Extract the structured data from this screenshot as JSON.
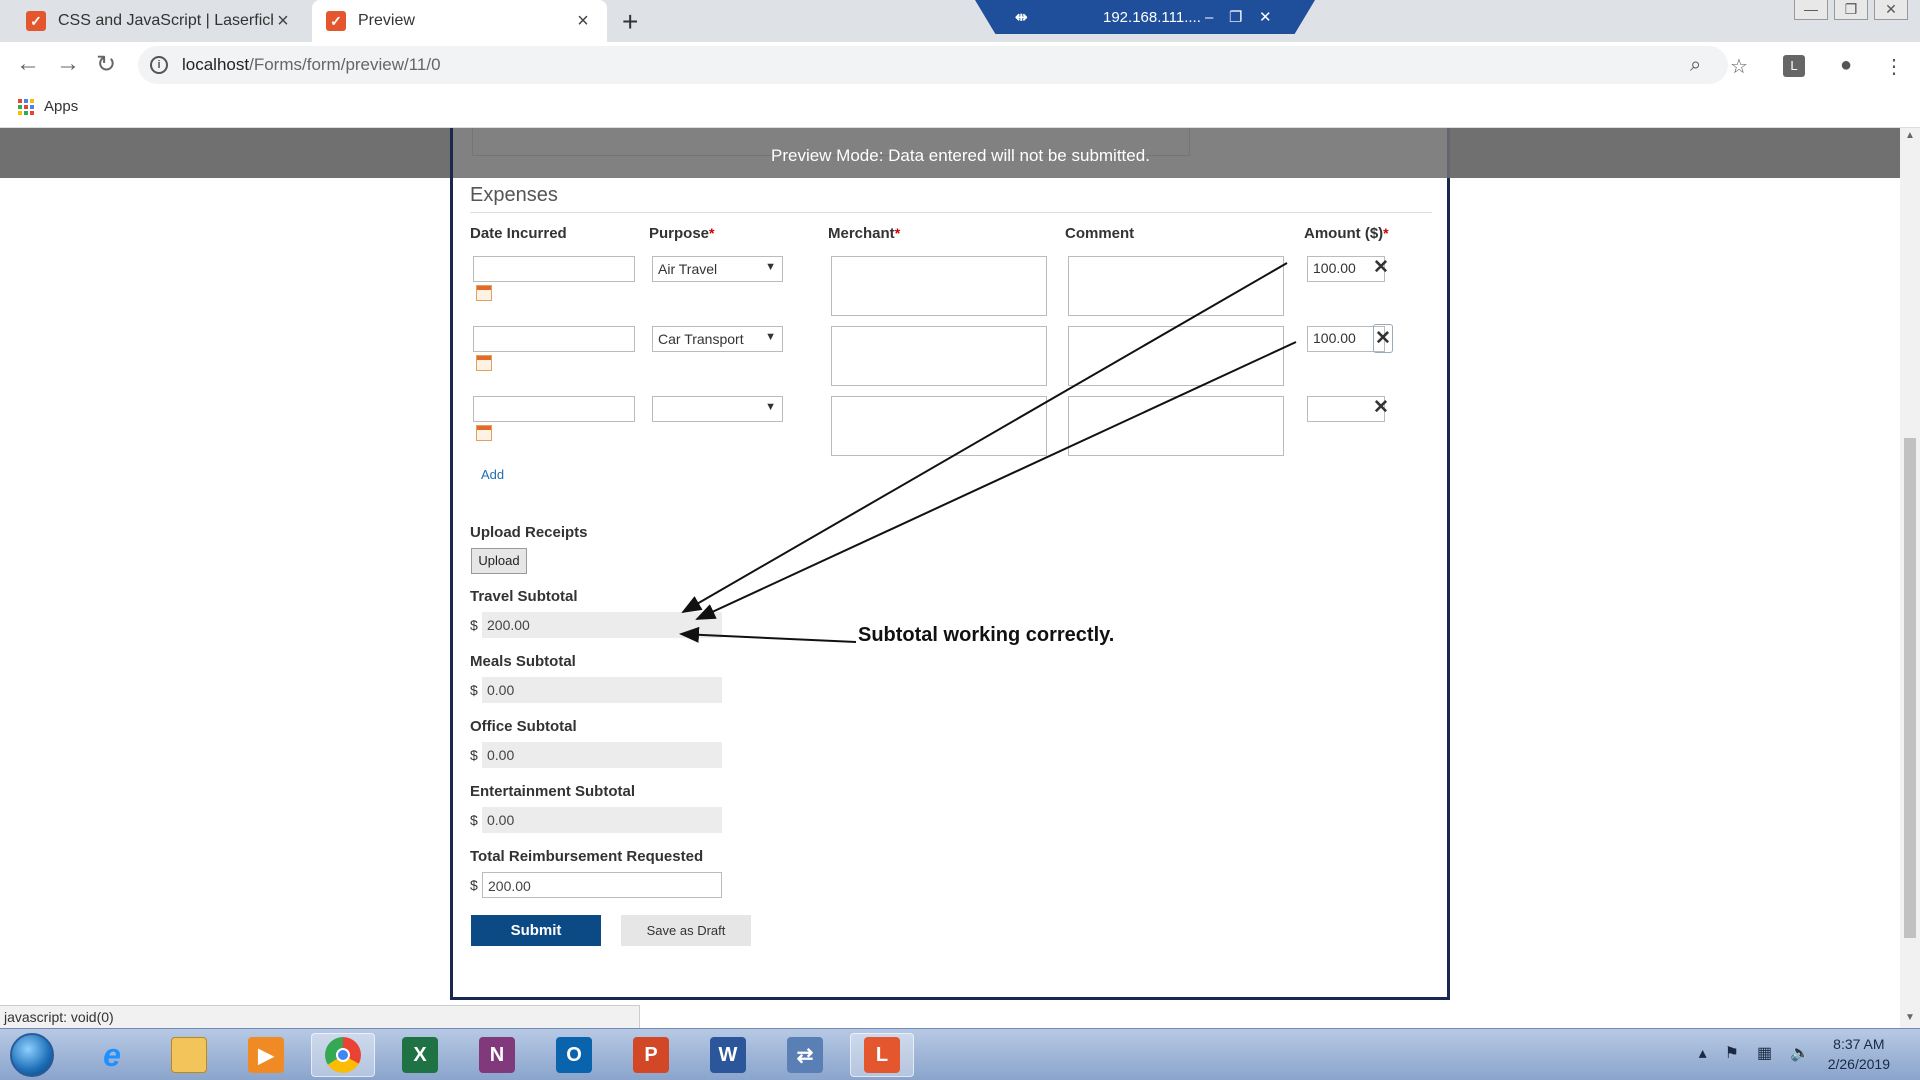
{
  "browser": {
    "tabs": [
      {
        "title": "CSS and JavaScript | Laserfiche Fo",
        "active": false
      },
      {
        "title": "Preview",
        "active": true
      }
    ],
    "url_host": "localhost",
    "url_path": "/Forms/form/preview/11/0",
    "remote_bar_ip": "192.168.111....",
    "extension_letter": "L"
  },
  "bookmarks": {
    "apps_label": "Apps"
  },
  "banner": {
    "text": "Preview Mode: Data entered will not be submitted."
  },
  "form": {
    "section_title": "Expenses",
    "columns": {
      "date": "Date Incurred",
      "purpose": "Purpose",
      "merchant": "Merchant",
      "comment": "Comment",
      "amount": "Amount ($)",
      "required_mark": "*"
    },
    "rows": [
      {
        "date": "",
        "purpose": "Air Travel",
        "merchant": "",
        "comment": "",
        "amount": "100.00"
      },
      {
        "date": "",
        "purpose": "Car Transport",
        "merchant": "",
        "comment": "",
        "amount": "100.00"
      },
      {
        "date": "",
        "purpose": "",
        "merchant": "",
        "comment": "",
        "amount": ""
      }
    ],
    "add_link": "Add",
    "upload_label": "Upload Receipts",
    "upload_button": "Upload",
    "currency": "$",
    "travel_label": "Travel Subtotal",
    "travel_value": "200.00",
    "meals_label": "Meals Subtotal",
    "meals_value": "0.00",
    "office_label": "Office Subtotal",
    "office_value": "0.00",
    "entertainment_label": "Entertainment Subtotal",
    "entertainment_value": "0.00",
    "total_label": "Total Reimbursement Requested",
    "total_value": "200.00",
    "submit_button": "Submit",
    "draft_button": "Save as Draft"
  },
  "annotation": {
    "text": "Subtotal working correctly."
  },
  "status_bar": {
    "text": "javascript: void(0)"
  },
  "taskbar": {
    "apps": [
      "internet-explorer",
      "file-explorer",
      "media-player",
      "chrome",
      "excel",
      "onenote",
      "outlook",
      "powerpoint",
      "word",
      "network-tool",
      "laserfiche"
    ],
    "time": "8:37 AM",
    "date": "2/26/2019"
  },
  "colors": {
    "accent": "#0b4a85",
    "banner": "#707070",
    "form_border": "#1a2750",
    "link": "#1f6fb5",
    "required": "#cc0000"
  }
}
